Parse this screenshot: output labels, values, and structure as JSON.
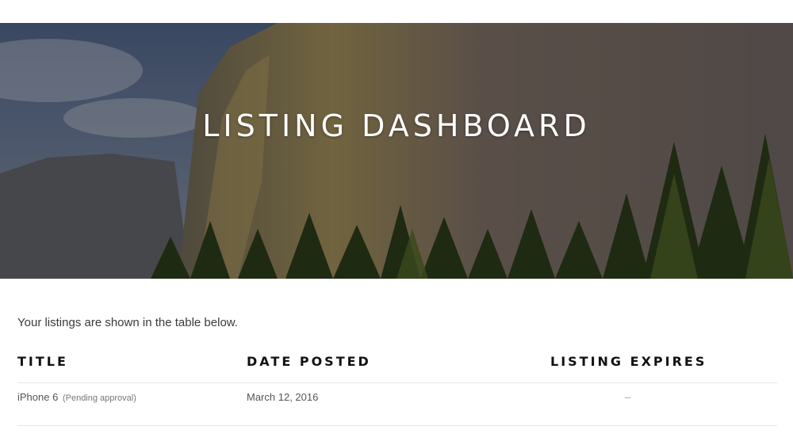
{
  "hero": {
    "title": "LISTING DASHBOARD"
  },
  "intro": "Your listings are shown in the table below.",
  "table": {
    "headers": {
      "title": "TITLE",
      "date_posted": "DATE POSTED",
      "listing_expires": "LISTING EXPIRES"
    },
    "rows": [
      {
        "title": "iPhone 6",
        "status": "(Pending approval)",
        "date_posted": "March 12, 2016",
        "listing_expires": "–"
      }
    ]
  }
}
